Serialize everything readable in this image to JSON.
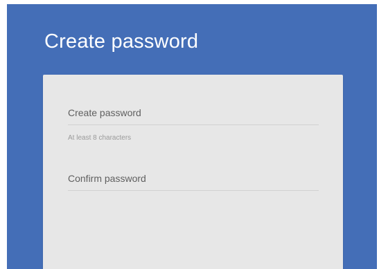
{
  "page": {
    "title": "Create password"
  },
  "form": {
    "create_password": {
      "placeholder": "Create password",
      "value": ""
    },
    "hint": "At least 8 characters",
    "confirm_password": {
      "placeholder": "Confirm password",
      "value": ""
    }
  },
  "colors": {
    "background": "#446eb7",
    "card": "#e7e7e7",
    "title_text": "#ffffff"
  }
}
